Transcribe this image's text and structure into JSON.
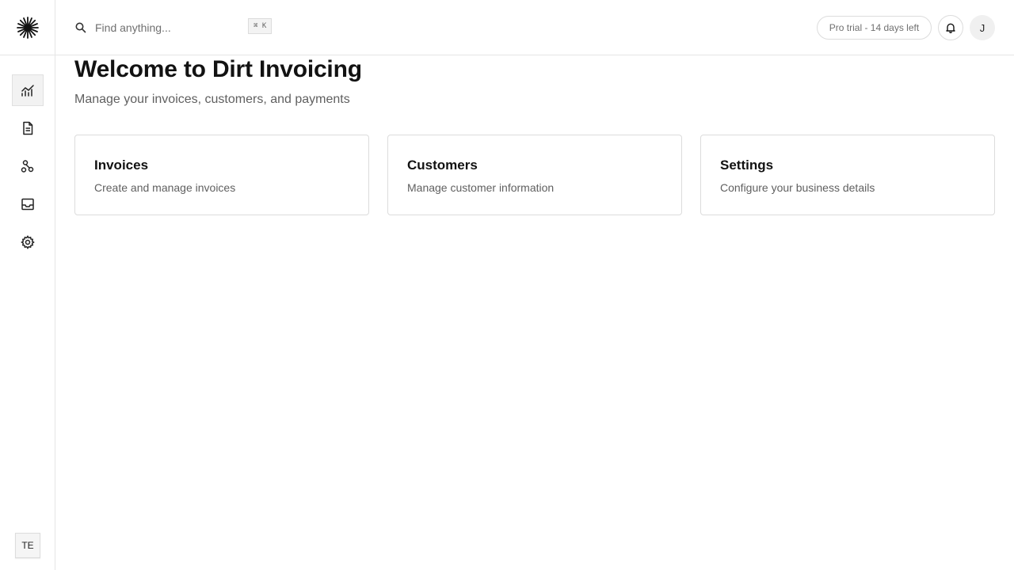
{
  "header": {
    "search": {
      "placeholder": "Find anything..."
    },
    "shortcut": "⌘ K",
    "trial_badge": "Pro trial - 14 days left",
    "avatar_initial": "J"
  },
  "sidebar": {
    "items": [
      {
        "icon": "chart-icon",
        "active": true
      },
      {
        "icon": "document-icon",
        "active": false
      },
      {
        "icon": "customers-icon",
        "active": false
      },
      {
        "icon": "inbox-icon",
        "active": false
      },
      {
        "icon": "gear-icon",
        "active": false
      }
    ],
    "team_initials": "TE"
  },
  "main": {
    "title": "Welcome to Dirt Invoicing",
    "subtitle": "Manage your invoices, customers, and payments",
    "cards": [
      {
        "title": "Invoices",
        "description": "Create and manage invoices"
      },
      {
        "title": "Customers",
        "description": "Manage customer information"
      },
      {
        "title": "Settings",
        "description": "Configure your business details"
      }
    ]
  }
}
